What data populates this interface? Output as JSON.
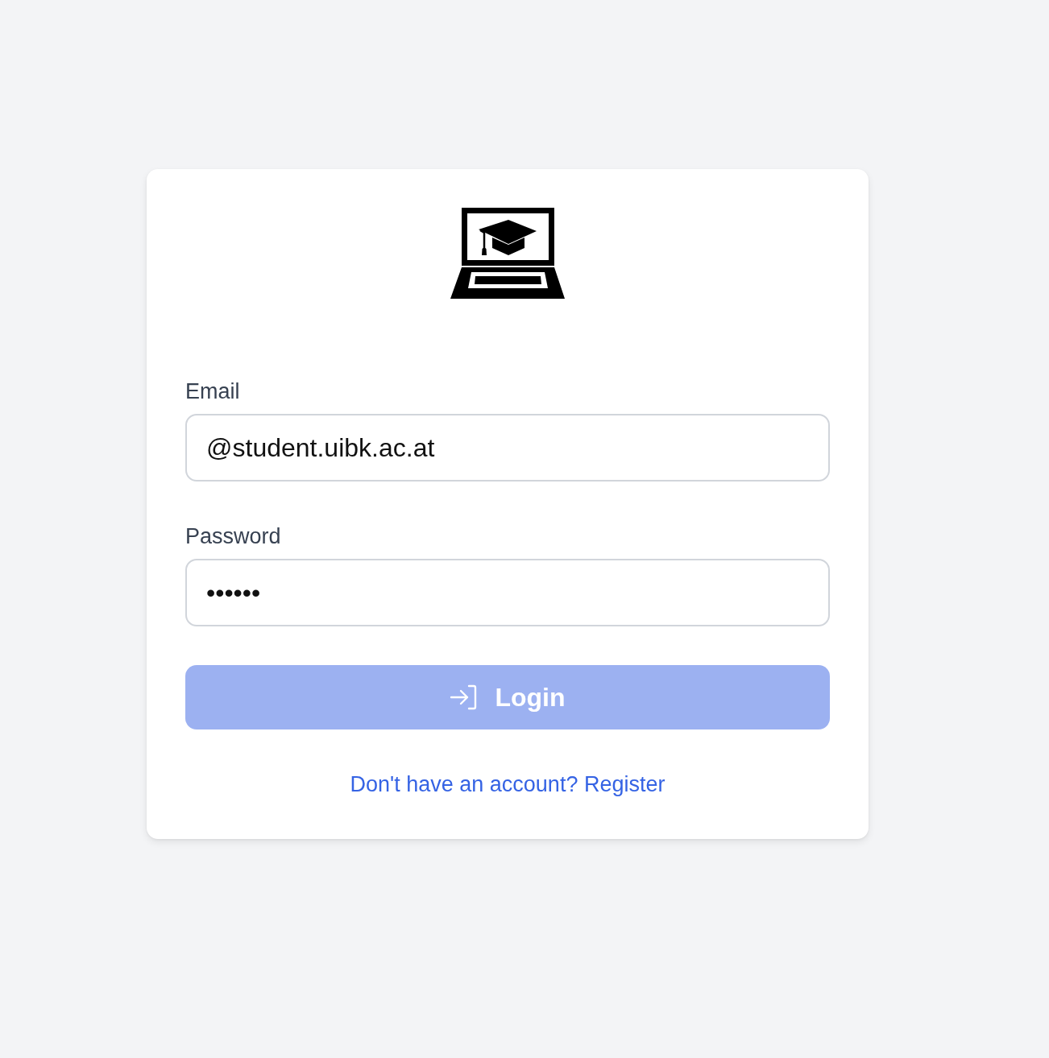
{
  "fields": [
    {
      "label": "Email",
      "value": "@student.uibk.ac.at"
    },
    {
      "label": "Password",
      "value": "••••••"
    }
  ],
  "login_button": {
    "label": "Login",
    "disabled": true
  },
  "register_link": {
    "text": "Don't have an account? Register"
  }
}
